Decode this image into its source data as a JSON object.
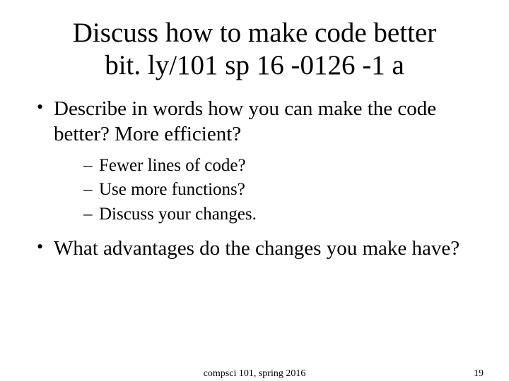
{
  "title_line1": "Discuss how to make code better",
  "title_line2": "bit. ly/101 sp 16 -0126 -1 a",
  "bullets": [
    "Describe in words how you can make the code better? More efficient?",
    "What advantages do the changes you make have?"
  ],
  "sub_bullets": [
    "Fewer lines of code?",
    "Use more functions?",
    "Discuss your changes."
  ],
  "footer": {
    "course": "compsci 101, spring 2016",
    "page": "19"
  }
}
